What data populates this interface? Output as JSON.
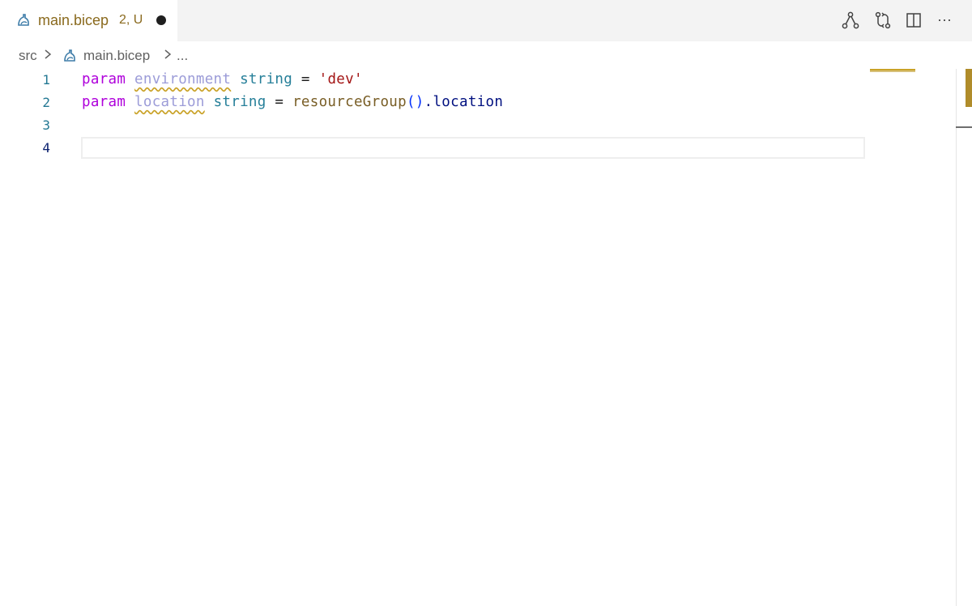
{
  "tab": {
    "label": "main.bicep",
    "status": "2, U",
    "icon": "bicep-file-icon"
  },
  "actions": [
    {
      "name": "visualize-icon"
    },
    {
      "name": "compare-changes-icon"
    },
    {
      "name": "split-editor-icon"
    },
    {
      "name": "more-actions-icon",
      "glyph": "···"
    }
  ],
  "breadcrumb": {
    "folder": "src",
    "file": "main.bicep",
    "more": "..."
  },
  "editor": {
    "lines": [
      {
        "number": "1",
        "tokens": [
          {
            "text": "param",
            "cls": "kw"
          },
          {
            "text": " ",
            "cls": "op"
          },
          {
            "text": "environment",
            "cls": "ident"
          },
          {
            "text": " ",
            "cls": "op"
          },
          {
            "text": "string",
            "cls": "type"
          },
          {
            "text": " = ",
            "cls": "op"
          },
          {
            "text": "'dev'",
            "cls": "str"
          }
        ]
      },
      {
        "number": "2",
        "tokens": [
          {
            "text": "param",
            "cls": "kw"
          },
          {
            "text": " ",
            "cls": "op"
          },
          {
            "text": "location",
            "cls": "ident"
          },
          {
            "text": " ",
            "cls": "op"
          },
          {
            "text": "string",
            "cls": "type"
          },
          {
            "text": " = ",
            "cls": "op"
          },
          {
            "text": "resourceGroup",
            "cls": "fn"
          },
          {
            "text": "()",
            "cls": "paren"
          },
          {
            "text": ".location",
            "cls": "prop"
          }
        ]
      },
      {
        "number": "3",
        "tokens": []
      },
      {
        "number": "4",
        "tokens": []
      }
    ],
    "active_line": 4
  },
  "colors": {
    "keyword": "#af00db",
    "type": "#267f99",
    "string": "#a31515",
    "function": "#795e26",
    "warning_squiggle": "#c9a227"
  }
}
